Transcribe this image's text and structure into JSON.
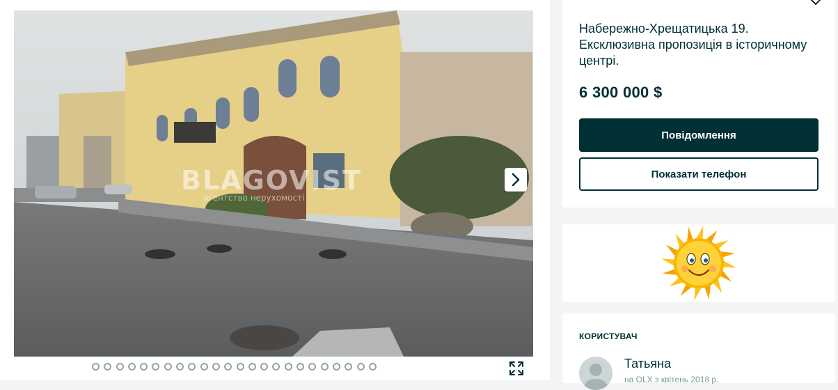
{
  "gallery": {
    "watermark": "BLAGOVIST",
    "watermark_sub": "агентство нерухомості",
    "slide_count": 24,
    "active_slide": 1
  },
  "offer": {
    "title": "Набережно-Хрещатицька 19. Ексклюзивна пропозиція в історичному центрі.",
    "price": "6 300 000 $",
    "message_button": "Повідомлення",
    "phone_button": "Показати телефон"
  },
  "ad": {
    "image_name": "sun-smiley"
  },
  "user": {
    "heading": "Користувач",
    "name": "Татьяна",
    "since": "на OLX з квітень 2018 р."
  },
  "colors": {
    "brand_dark": "#002f34",
    "background": "#f2f4f5",
    "dot_border": "#93a2a5"
  }
}
